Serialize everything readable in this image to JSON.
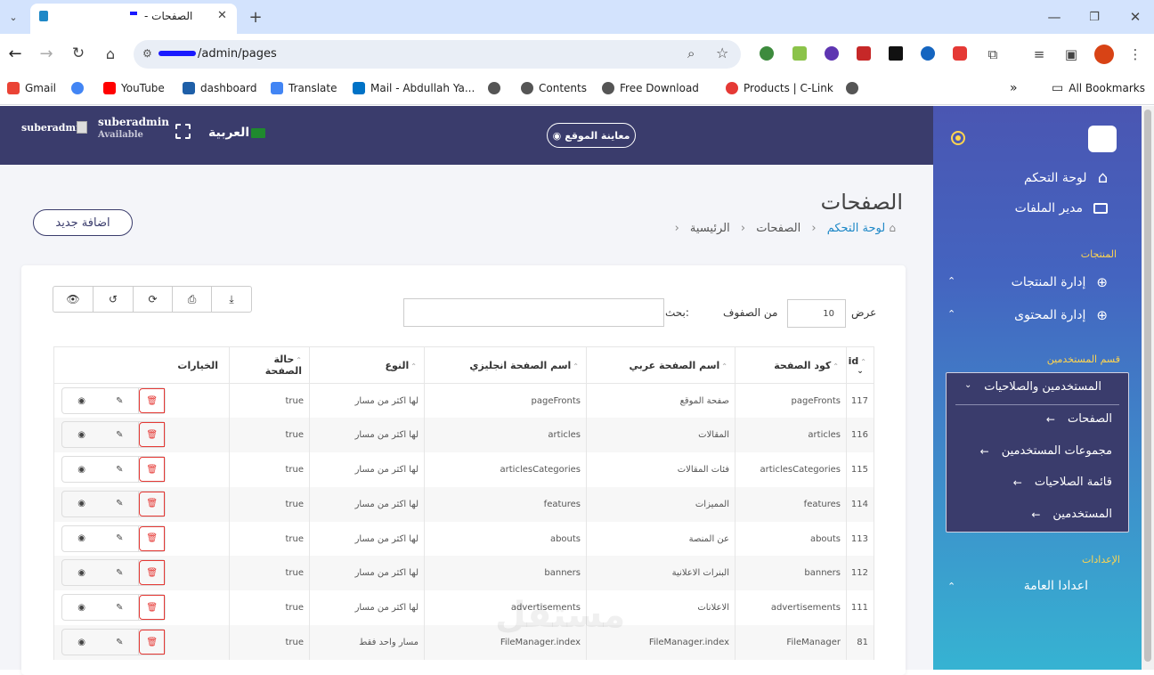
{
  "browser": {
    "tab_title": "الصفحات - ",
    "url": "/admin/pages",
    "bookmarks": [
      "Gmail",
      "YouTube",
      "dashboard",
      "Translate",
      "Mail - Abdullah Ya...",
      "Contents",
      "Free Download",
      "Products | C-Link"
    ],
    "all_bookmarks": "All Bookmarks"
  },
  "topbar": {
    "user_name": "suberadmin",
    "user_status": "Available",
    "avatar_alt": "suberadmin",
    "language": "العربية",
    "view_site": "معاينة الموقع"
  },
  "page": {
    "title": "الصفحات",
    "breadcrumb": [
      "لوحة التحكم",
      "الصفحات",
      "الرئيسية"
    ],
    "add_new": "اضافة جديد",
    "show_label": "عرض",
    "page_size": "10",
    "rows_label": "من الصفوف",
    "search_label": "بحث:"
  },
  "table": {
    "headers": [
      "id",
      "كود الصفحة",
      "اسم الصفحة عربي",
      "اسم الصفحة انجليزي",
      "النوع",
      "حالة الصفحة",
      "الخيارات"
    ],
    "rows": [
      [
        "117",
        "pageFronts",
        "صفحة الموقع",
        "pageFronts",
        "لها اكثر من مسار",
        "true"
      ],
      [
        "116",
        "articles",
        "المقالات",
        "articles",
        "لها اكثر من مسار",
        "true"
      ],
      [
        "115",
        "articlesCategories",
        "فئات المقالات",
        "articlesCategories",
        "لها اكثر من مسار",
        "true"
      ],
      [
        "114",
        "features",
        "المميزات",
        "features",
        "لها اكثر من مسار",
        "true"
      ],
      [
        "113",
        "abouts",
        "عن المنصة",
        "abouts",
        "لها اكثر من مسار",
        "true"
      ],
      [
        "112",
        "banners",
        "البنرات الاعلانية",
        "banners",
        "لها اكثر من مسار",
        "true"
      ],
      [
        "111",
        "advertisements",
        "الاعلانات",
        "advertisements",
        "لها اكثر من مسار",
        "true"
      ],
      [
        "81",
        "FileManager",
        "FileManager.index",
        "FileManager.index",
        "مسار واحد فقط",
        "true"
      ]
    ]
  },
  "sidebar": {
    "dashboard": "لوحة التحكم",
    "file_manager": "مدير الملفات",
    "section_products": "المنتجات",
    "manage_products": "إدارة المنتجات",
    "manage_content": "إدارة المحتوى",
    "section_users": "قسم المستخدمين",
    "users_permissions": "المستخدمين والصلاحيات",
    "submenu": [
      "الصفحات",
      "مجموعات المستخدمين",
      "قائمة الصلاحيات",
      "المستخدمين"
    ],
    "section_settings": "الإعدادات",
    "general_settings": "اعدادا العامة"
  },
  "colors": {
    "topbar": "#3a3c6c",
    "accent": "#1e88c7",
    "danger": "#e53935"
  }
}
